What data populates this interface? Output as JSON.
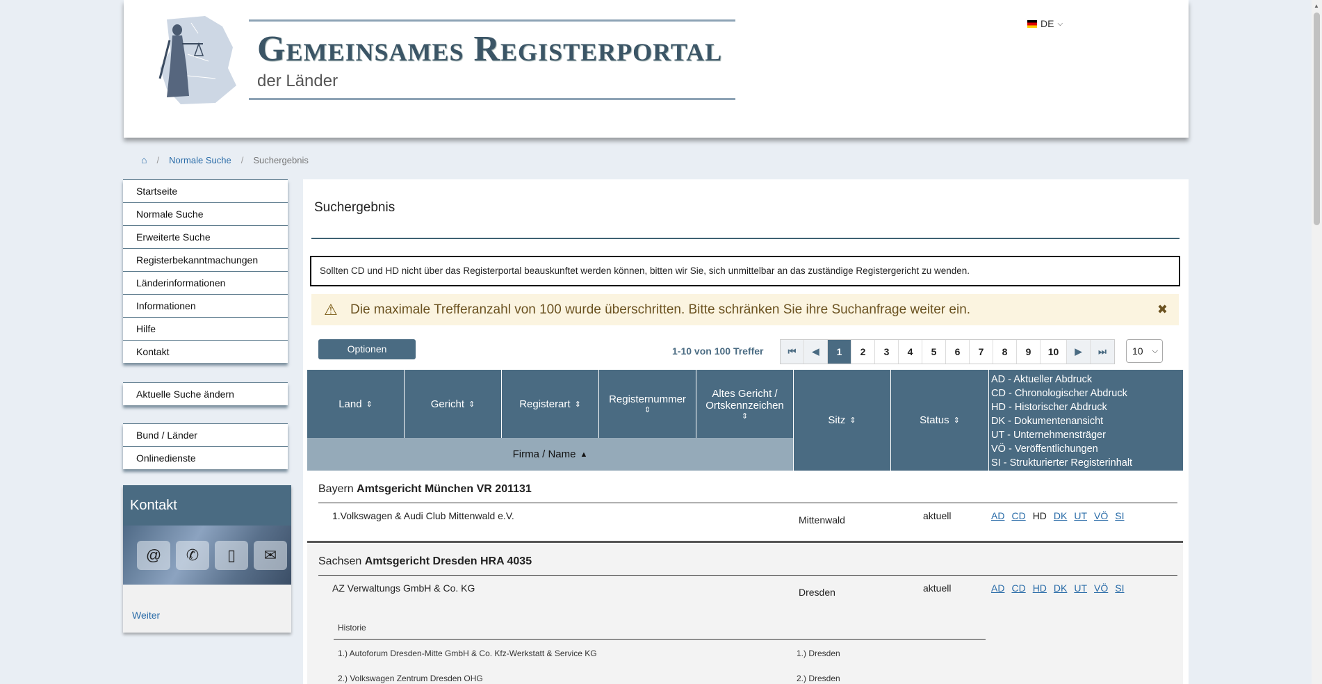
{
  "header": {
    "title": "Gemeinsames Registerportal",
    "subtitle": "der Länder",
    "language": "DE"
  },
  "breadcrumb": {
    "home_icon": "home-icon",
    "items": [
      "Normale Suche",
      "Suchergebnis"
    ]
  },
  "sidebar": {
    "main_nav": [
      "Startseite",
      "Normale Suche",
      "Erweiterte Suche",
      "Registerbekanntmachungen",
      "Länderinformationen",
      "Informationen",
      "Hilfe",
      "Kontakt"
    ],
    "search_nav": [
      "Aktuelle Suche ändern"
    ],
    "extra_nav": [
      "Bund / Länder",
      "Onlinedienste"
    ],
    "kontakt": {
      "title": "Kontakt",
      "icons": [
        "@",
        "phone-icon",
        "mobile-icon",
        "mail-icon"
      ],
      "link": "Weiter"
    }
  },
  "main": {
    "title": "Suchergebnis",
    "info": "Sollten CD und HD nicht über das Registerportal beauskunftet werden können, bitten wir Sie, sich unmittelbar an das zuständige Registergericht zu wenden.",
    "warning": "Die maximale Trefferanzahl von 100 wurde überschritten. Bitte schränken Sie ihre Suchanfrage weiter ein.",
    "options_button": "Optionen",
    "hits": "1-10 von 100 Treffer",
    "pages": [
      "1",
      "2",
      "3",
      "4",
      "5",
      "6",
      "7",
      "8",
      "9",
      "10"
    ],
    "current_page": 1,
    "page_size": "10",
    "columns": {
      "land": "Land",
      "gericht": "Gericht",
      "registerart": "Registerart",
      "registernummer": "Registernummer",
      "altes_gericht": "Altes Gericht / Ortskennzeichen",
      "firma": "Firma / Name",
      "sitz": "Sitz",
      "status": "Status"
    },
    "legend": [
      "AD - Aktueller Abdruck",
      "CD - Chronologischer Abdruck",
      "HD - Historischer Abdruck",
      "DK - Dokumentenansicht",
      "UT - Unternehmensträger",
      "VÖ - Veröffentlichungen",
      "SI - Strukturierter Registerinhalt"
    ],
    "results": [
      {
        "land": "Bayern",
        "gericht": "Amtsgericht München VR 201131",
        "name": "1.Volkswagen & Audi Club Mittenwald e.V.",
        "sitz": "Mittenwald",
        "status": "aktuell",
        "docs": [
          "AD",
          "CD",
          "HD",
          "DK",
          "UT",
          "VÖ",
          "SI"
        ]
      },
      {
        "land": "Sachsen",
        "gericht": "Amtsgericht Dresden HRA 4035",
        "name": "AZ Verwaltungs GmbH & Co. KG",
        "sitz": "Dresden",
        "status": "aktuell",
        "docs": [
          "AD",
          "CD",
          "HD",
          "DK",
          "UT",
          "VÖ",
          "SI"
        ],
        "historie_label": "Historie",
        "historie": [
          {
            "name": "1.) Autoforum Dresden-Mitte GmbH & Co. Kfz-Werkstatt & Service KG",
            "sitz": "1.) Dresden"
          },
          {
            "name": "2.) Volkswagen Zentrum Dresden OHG",
            "sitz": "2.) Dresden"
          }
        ]
      }
    ]
  }
}
